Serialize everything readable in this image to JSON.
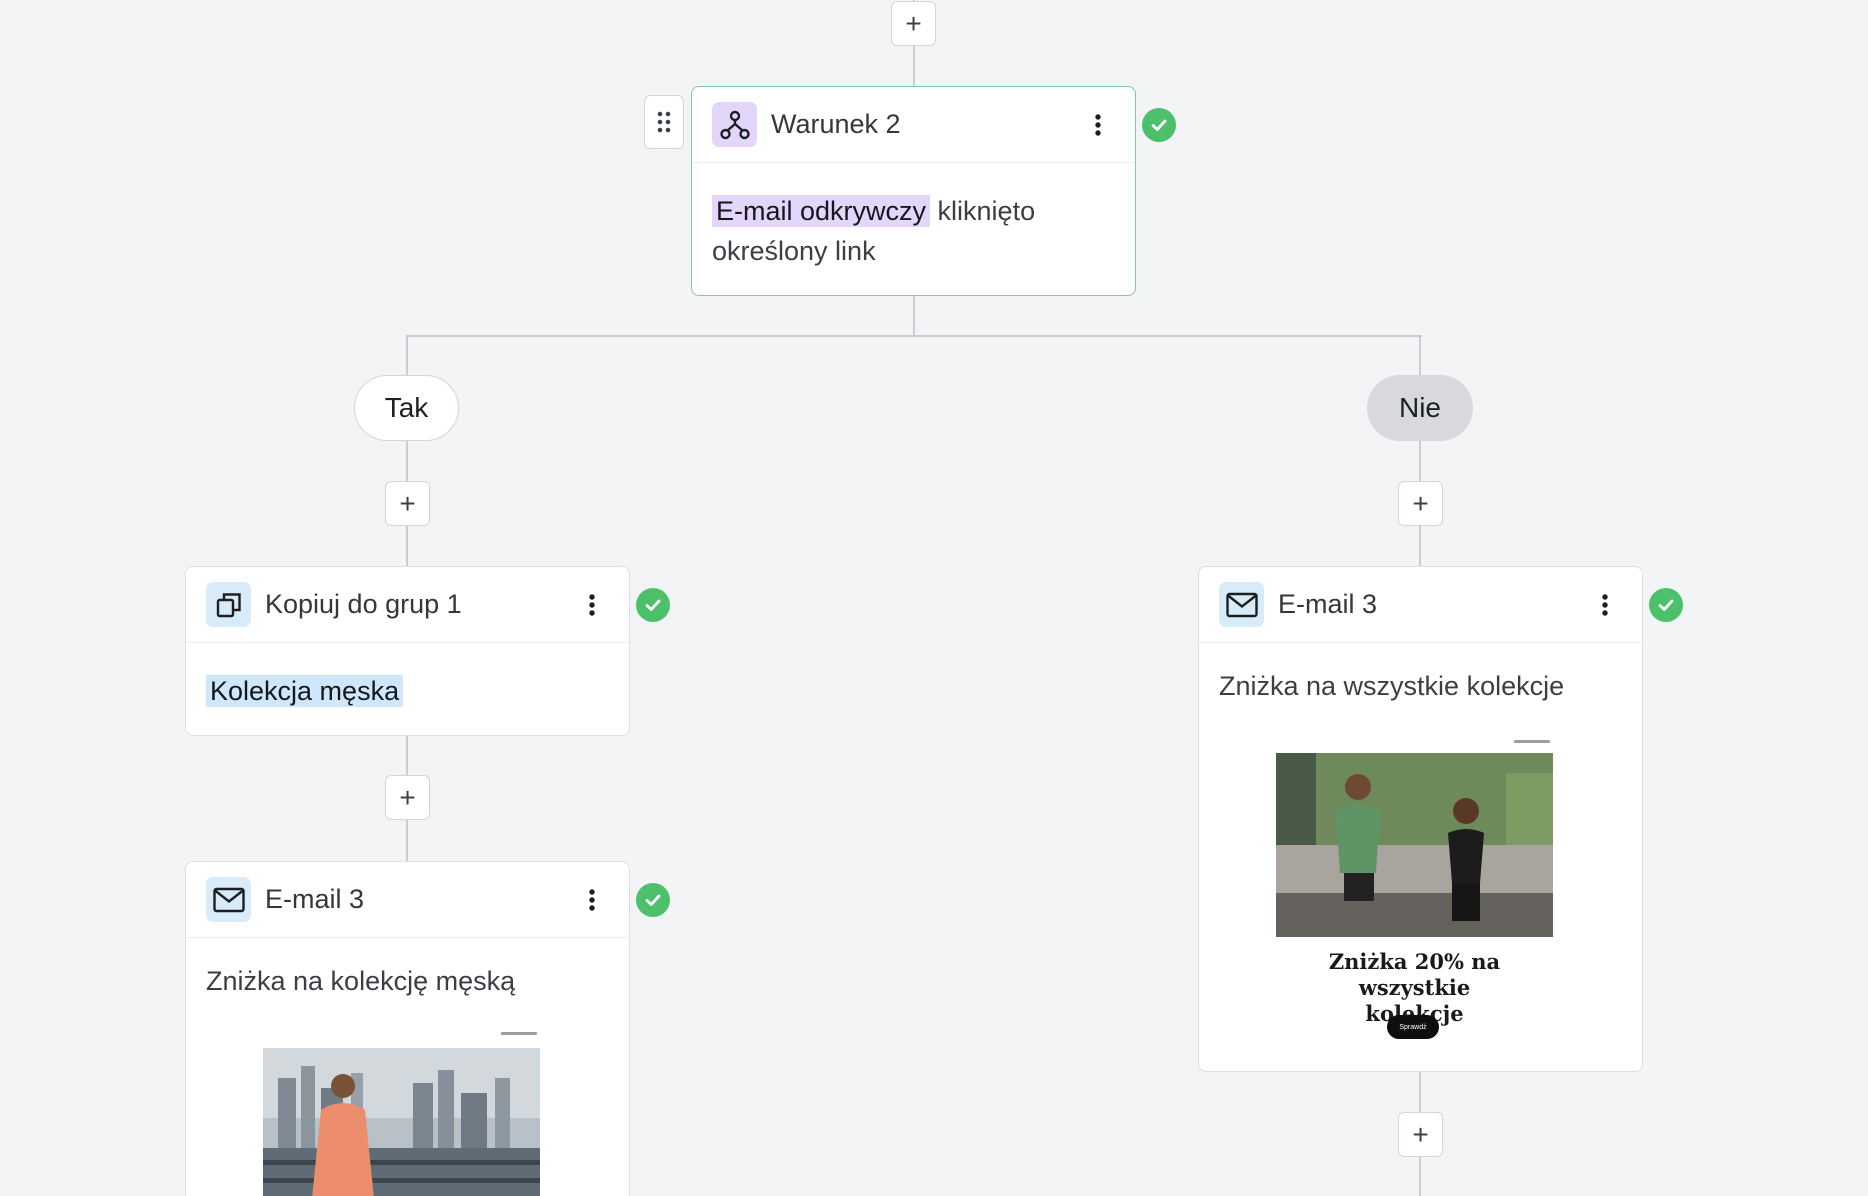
{
  "add_step_symbol": "+",
  "condition": {
    "title": "Warunek 2",
    "tag": "E-mail odkrywczy",
    "text": "kliknięto określony link"
  },
  "branches": {
    "yes_label": "Tak",
    "no_label": "Nie"
  },
  "yes_branch": {
    "copy_step": {
      "title": "Kopiuj do grup 1",
      "tag": "Kolekcja męska"
    },
    "email_step": {
      "title": "E-mail 3",
      "subject": "Zniżka na kolekcję męską"
    }
  },
  "no_branch": {
    "email_step": {
      "title": "E-mail 3",
      "subject": "Zniżka na wszystkie kolekcje",
      "preview_headline": "Zniżka 20% na wszystkie kolekcje",
      "preview_button": "Sprawdź"
    }
  },
  "colors": {
    "success": "#4cc06a",
    "condition_accent": "#e4d6fb",
    "email_accent": "#d8ebf8",
    "active_border": "#7ccf94"
  },
  "icons": {
    "condition": "branch-icon",
    "copy": "copy-icon",
    "email": "envelope-icon",
    "status": "check-icon",
    "menu": "kebab-icon",
    "drag": "drag-handle-icon"
  }
}
